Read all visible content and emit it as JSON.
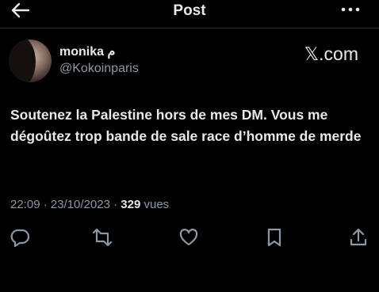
{
  "header": {
    "title": "Post",
    "back_icon": "arrow-left-icon",
    "more_icon": "more-horizontal-icon"
  },
  "author": {
    "display_name": "monika م",
    "handle": "@Kokoinparis"
  },
  "watermark": "𝕏.com",
  "tweet": {
    "text": "Soutenez la Palestine hors de mes DM. Vous me dégoûtez trop bande de sale race d’homme de merde",
    "timestamp": "22:09 · 23/10/2023 · ",
    "views_count": "329",
    "views_label": " vues"
  },
  "actions": [
    {
      "icon": "reply-icon"
    },
    {
      "icon": "retweet-icon"
    },
    {
      "icon": "like-icon"
    },
    {
      "icon": "bookmark-icon"
    },
    {
      "icon": "share-icon"
    }
  ],
  "colors": {
    "background": "#000000",
    "text": "#e7e9ea",
    "muted": "#8b98a5"
  }
}
